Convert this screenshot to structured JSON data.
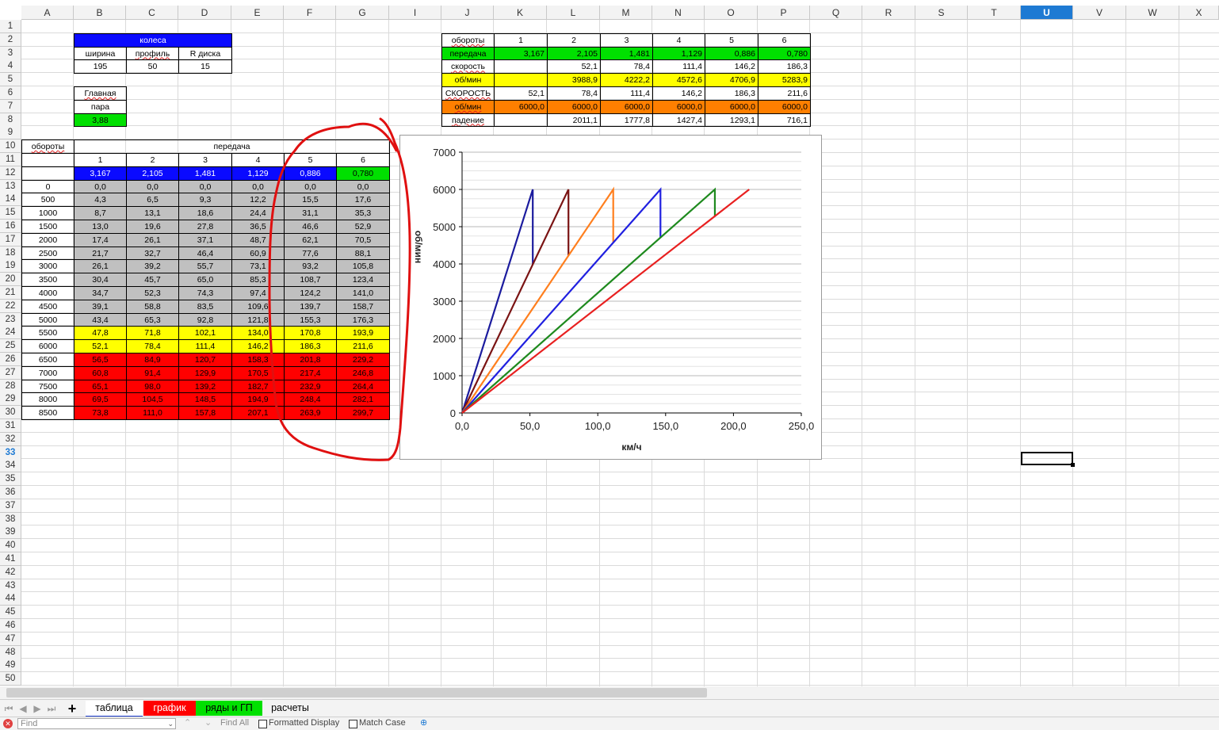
{
  "columns": [
    "A",
    "B",
    "C",
    "D",
    "E",
    "F",
    "G",
    "I",
    "J",
    "K",
    "L",
    "M",
    "N",
    "O",
    "P",
    "Q",
    "R",
    "S",
    "T",
    "U",
    "V",
    "W",
    "X"
  ],
  "selected_column": "U",
  "selected_row": "33",
  "wheels": {
    "title": "колеса",
    "headers": [
      "ширина",
      "профиль",
      "R диска"
    ],
    "values": [
      "195",
      "50",
      "15"
    ]
  },
  "main_pair": {
    "label1": "Главная",
    "label2": "пара",
    "value": "3,88"
  },
  "gear_table": {
    "rpm_header": "обороты",
    "gear_header": "передача",
    "gear_numbers": [
      "1",
      "2",
      "3",
      "4",
      "5",
      "6"
    ],
    "ratios": [
      "3,167",
      "2,105",
      "1,481",
      "1,129",
      "0,886",
      "0,780"
    ],
    "rows": [
      {
        "rpm": "0",
        "v": [
          "0,0",
          "0,0",
          "0,0",
          "0,0",
          "0,0",
          "0,0"
        ],
        "band": "gray"
      },
      {
        "rpm": "500",
        "v": [
          "4,3",
          "6,5",
          "9,3",
          "12,2",
          "15,5",
          "17,6"
        ],
        "band": "gray"
      },
      {
        "rpm": "1000",
        "v": [
          "8,7",
          "13,1",
          "18,6",
          "24,4",
          "31,1",
          "35,3"
        ],
        "band": "gray"
      },
      {
        "rpm": "1500",
        "v": [
          "13,0",
          "19,6",
          "27,8",
          "36,5",
          "46,6",
          "52,9"
        ],
        "band": "gray"
      },
      {
        "rpm": "2000",
        "v": [
          "17,4",
          "26,1",
          "37,1",
          "48,7",
          "62,1",
          "70,5"
        ],
        "band": "gray"
      },
      {
        "rpm": "2500",
        "v": [
          "21,7",
          "32,7",
          "46,4",
          "60,9",
          "77,6",
          "88,1"
        ],
        "band": "gray"
      },
      {
        "rpm": "3000",
        "v": [
          "26,1",
          "39,2",
          "55,7",
          "73,1",
          "93,2",
          "105,8"
        ],
        "band": "gray"
      },
      {
        "rpm": "3500",
        "v": [
          "30,4",
          "45,7",
          "65,0",
          "85,3",
          "108,7",
          "123,4"
        ],
        "band": "gray"
      },
      {
        "rpm": "4000",
        "v": [
          "34,7",
          "52,3",
          "74,3",
          "97,4",
          "124,2",
          "141,0"
        ],
        "band": "gray"
      },
      {
        "rpm": "4500",
        "v": [
          "39,1",
          "58,8",
          "83,5",
          "109,6",
          "139,7",
          "158,7"
        ],
        "band": "gray"
      },
      {
        "rpm": "5000",
        "v": [
          "43,4",
          "65,3",
          "92,8",
          "121,8",
          "155,3",
          "176,3"
        ],
        "band": "gray"
      },
      {
        "rpm": "5500",
        "v": [
          "47,8",
          "71,8",
          "102,1",
          "134,0",
          "170,8",
          "193,9"
        ],
        "band": "yellow"
      },
      {
        "rpm": "6000",
        "v": [
          "52,1",
          "78,4",
          "111,4",
          "146,2",
          "186,3",
          "211,6"
        ],
        "band": "yellow"
      },
      {
        "rpm": "6500",
        "v": [
          "56,5",
          "84,9",
          "120,7",
          "158,3",
          "201,8",
          "229,2"
        ],
        "band": "red"
      },
      {
        "rpm": "7000",
        "v": [
          "60,8",
          "91,4",
          "129,9",
          "170,5",
          "217,4",
          "246,8"
        ],
        "band": "red"
      },
      {
        "rpm": "7500",
        "v": [
          "65,1",
          "98,0",
          "139,2",
          "182,7",
          "232,9",
          "264,4"
        ],
        "band": "red"
      },
      {
        "rpm": "8000",
        "v": [
          "69,5",
          "104,5",
          "148,5",
          "194,9",
          "248,4",
          "282,1"
        ],
        "band": "red"
      },
      {
        "rpm": "8500",
        "v": [
          "73,8",
          "111,0",
          "157,8",
          "207,1",
          "263,9",
          "299,7"
        ],
        "band": "red"
      }
    ]
  },
  "shift_table": {
    "rows": [
      {
        "label": "обороты",
        "v": [
          "1",
          "2",
          "3",
          "4",
          "5",
          "6"
        ]
      },
      {
        "label": "передача",
        "v": [
          "3,167",
          "2,105",
          "1,481",
          "1,129",
          "0,886",
          "0,780"
        ]
      },
      {
        "label": "скорость",
        "v": [
          "",
          "52,1",
          "78,4",
          "111,4",
          "146,2",
          "186,3"
        ]
      },
      {
        "label": "об/мин",
        "v": [
          "",
          "3988,9",
          "4222,2",
          "4572,6",
          "4706,9",
          "5283,9"
        ]
      },
      {
        "label": "СКОРОСТЬ",
        "v": [
          "52,1",
          "78,4",
          "111,4",
          "146,2",
          "186,3",
          "211,6"
        ]
      },
      {
        "label": "об/мин",
        "v": [
          "6000,0",
          "6000,0",
          "6000,0",
          "6000,0",
          "6000,0",
          "6000,0"
        ]
      },
      {
        "label": "падение",
        "v": [
          "",
          "2011,1",
          "1777,8",
          "1427,4",
          "1293,1",
          "716,1"
        ]
      }
    ]
  },
  "chart_data": {
    "type": "line",
    "xlabel": "км/ч",
    "ylabel": "об/мин",
    "xlim": [
      0,
      250
    ],
    "ylim": [
      0,
      7000
    ],
    "x_ticks": [
      "0,0",
      "50,0",
      "100,0",
      "150,0",
      "200,0",
      "250,0"
    ],
    "y_ticks": [
      "0",
      "1000",
      "2000",
      "3000",
      "4000",
      "5000",
      "6000",
      "7000"
    ],
    "grid": "horizontal",
    "legend": "none",
    "series": [
      {
        "color": "#1b1b9e",
        "points": [
          [
            0,
            0
          ],
          [
            52.1,
            6000
          ],
          [
            52.1,
            3988.9
          ]
        ]
      },
      {
        "color": "#7a1313",
        "points": [
          [
            0,
            0
          ],
          [
            78.4,
            6000
          ],
          [
            78.4,
            4222.2
          ]
        ]
      },
      {
        "color": "#ff7f1e",
        "points": [
          [
            0,
            0
          ],
          [
            111.4,
            6000
          ],
          [
            111.4,
            4572.6
          ]
        ]
      },
      {
        "color": "#2020e0",
        "points": [
          [
            0,
            0
          ],
          [
            146.2,
            6000
          ],
          [
            146.2,
            4706.9
          ]
        ]
      },
      {
        "color": "#1e8a1e",
        "points": [
          [
            0,
            0
          ],
          [
            186.3,
            6000
          ],
          [
            186.3,
            5283.9
          ]
        ]
      },
      {
        "color": "#e82020",
        "points": [
          [
            0,
            0
          ],
          [
            211.6,
            6000
          ]
        ]
      }
    ]
  },
  "sheet_tabs": [
    {
      "label": "таблица",
      "color": "#ffffff",
      "text": "#000000",
      "active": true
    },
    {
      "label": "график",
      "color": "#ff0000",
      "text": "#ffffff",
      "active": false
    },
    {
      "label": "ряды и ГП",
      "color": "#00e000",
      "text": "#000000",
      "active": false
    },
    {
      "label": "расчеты",
      "color": "#f3f3f3",
      "text": "#000000",
      "active": false
    }
  ],
  "find_bar": {
    "placeholder": "Find",
    "find_all": "Find All",
    "formatted_display": "Formatted Display",
    "match_case": "Match Case"
  },
  "colors": {
    "blue": "#0a0aff",
    "green": "#00e000",
    "gray": "#c0c0c0",
    "yellow": "#ffff00",
    "red": "#ff0000",
    "orange": "#ff7f00",
    "annotation": "#e01010"
  }
}
